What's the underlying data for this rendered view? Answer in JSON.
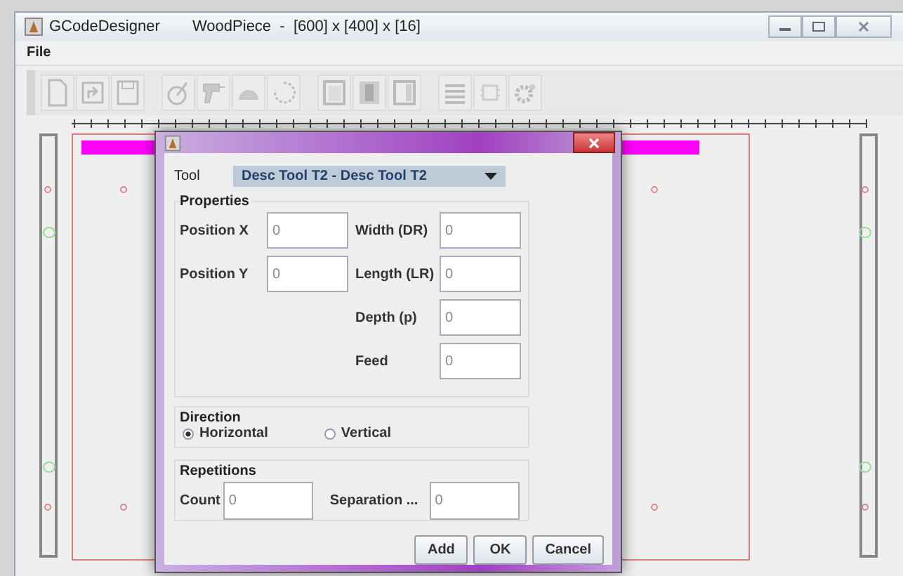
{
  "window": {
    "title": "GCodeDesigner",
    "document": "WoodPiece  -  [600] x [400] x [16]"
  },
  "menu": [
    "File"
  ],
  "dialog": {
    "tool": {
      "label": "Tool",
      "value": "Desc Tool T2 - Desc Tool T2"
    },
    "properties": {
      "title": "Properties",
      "left": [
        {
          "label": "Position X",
          "value": "0"
        },
        {
          "label": "Position Y",
          "value": "0"
        }
      ],
      "right": [
        {
          "label": "Width (DR)",
          "value": "0"
        },
        {
          "label": "Length (LR)",
          "value": "0"
        },
        {
          "label": "Depth (p)",
          "value": "0"
        },
        {
          "label": "Feed",
          "value": "0"
        }
      ]
    },
    "direction": {
      "title": "Direction",
      "options": [
        {
          "label": "Horizontal",
          "selected": true
        },
        {
          "label": "Vertical",
          "selected": false
        }
      ]
    },
    "repetitions": {
      "title": "Repetitions",
      "fields": [
        {
          "label": "Count",
          "value": "0"
        },
        {
          "label": "Separation ...",
          "value": "0"
        }
      ]
    },
    "buttons": [
      "Add",
      "OK",
      "Cancel"
    ]
  }
}
